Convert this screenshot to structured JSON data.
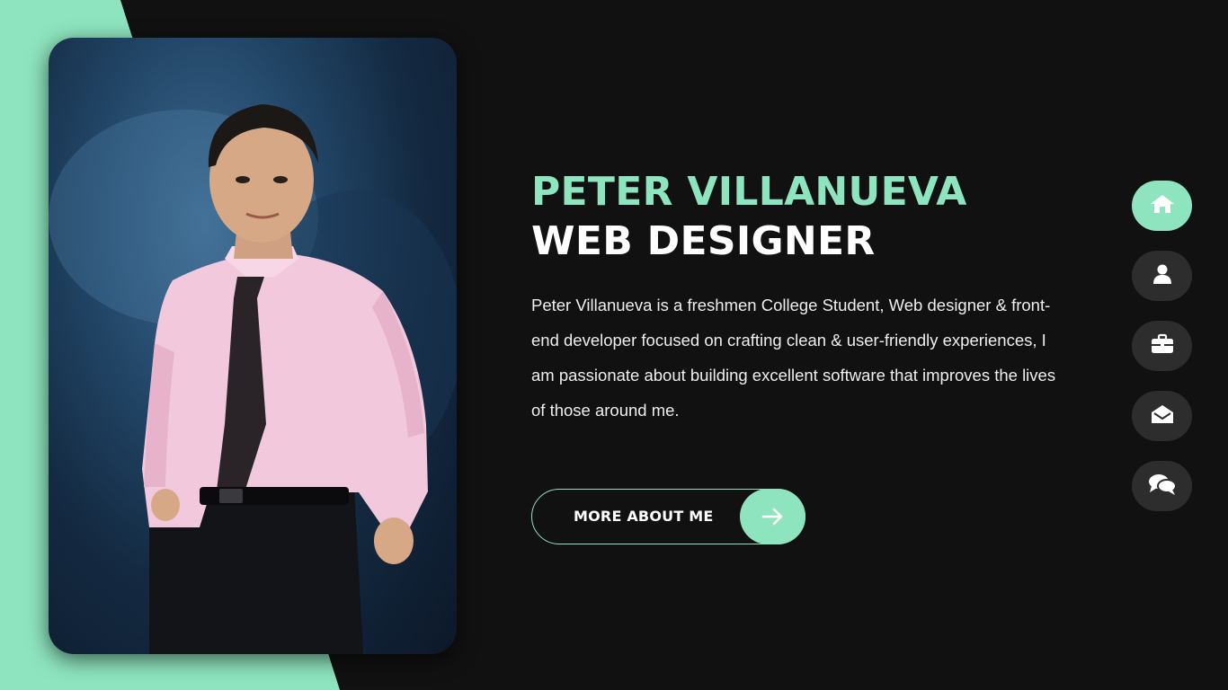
{
  "hero": {
    "name": "PETER VILLANUEVA",
    "role": "WEB DESIGNER",
    "bio": "Peter Villanueva is a freshmen College Student, Web designer & front-end developer focused on crafting clean & user-friendly experiences, I am passionate about building excellent software that improves the lives of those around me.",
    "cta_label": "MORE ABOUT ME",
    "cta_icon": "arrow-right-icon"
  },
  "nav": {
    "items": [
      {
        "icon": "home-icon",
        "active": true
      },
      {
        "icon": "user-icon",
        "active": false
      },
      {
        "icon": "briefcase-icon",
        "active": false
      },
      {
        "icon": "envelope-open-icon",
        "active": false
      },
      {
        "icon": "chat-bubbles-icon",
        "active": false
      }
    ]
  },
  "colors": {
    "accent": "#8ee4bf",
    "background": "#111111",
    "nav_inactive": "#2d2d2d",
    "text": "#ffffff"
  }
}
